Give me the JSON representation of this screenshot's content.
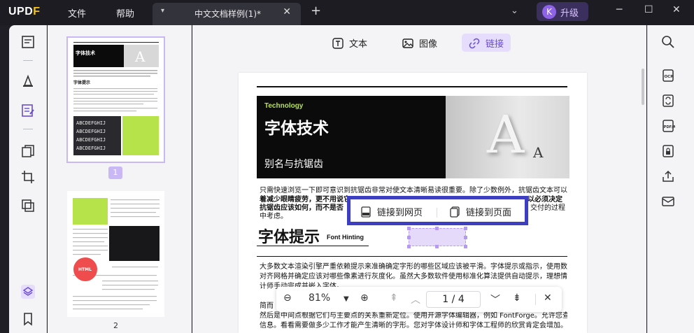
{
  "app": {
    "logo": "UPDF",
    "menus": [
      "文件",
      "帮助"
    ]
  },
  "tab": {
    "name": "中文文档样例(1)*"
  },
  "account": {
    "avatar": "K",
    "upgrade": "升级"
  },
  "toolbar": {
    "text": "文本",
    "image": "图像",
    "link": "链接"
  },
  "thumbs": {
    "page1": "1",
    "page2": "2"
  },
  "doc": {
    "tech": "Technology",
    "title": "字体技术",
    "subtitle": "别名与抗锯齿",
    "para1_l1": "只需快速浏览一下即可意识到抗锯齿非常对使文本清晰易读很重要。除了少数例外，抗锯齿文本可以是",
    "para1_l2": "着减少眼睛疲劳，更不用说它",
    "para1_l2b": "以必须决定",
    "para1_l3": "抗锯齿应该如何，而不是否",
    "para1_l3b": "交付的过程",
    "para1_l4": "中考虑。",
    "h2": "字体提示",
    "h2_en": "Font Hinting",
    "para2_l1": "大多数文本渲染引擎严重依赖提示来准确确定字形的哪些区域应该被平滑。字体提示或指示，使用数学指令表将字体与像素",
    "para2_l2": "对齐网格并确定应该对哪些像素进行灰度化。虽然大多数软件使用标准化算法提供自动提示，理想情况下该过程将由类型设",
    "para2_l3": "计师手动完成并嵌入字体。",
    "para3_l1": "简而",
    "para3_l2": "然后是中间点根据它们与主要点的关系重新定位。使用开源字体编辑器，例如 FontForge。允许您查看和编辑字体的提示",
    "para3_l3": "信息。看看需要做多少工作才能产生清晰的字形。您对字体设计师和字体工程师的欣赏肯定会增加。"
  },
  "link_popup": {
    "web": "链接到网页",
    "page": "链接到页面"
  },
  "zoom": {
    "value": "81%",
    "page_current": "1",
    "page_sep": "/",
    "page_total": "4"
  },
  "colors": {
    "accent": "#6a4bd3",
    "popup_border": "#3d3fc0",
    "banner_accent": "#b6e24a"
  }
}
